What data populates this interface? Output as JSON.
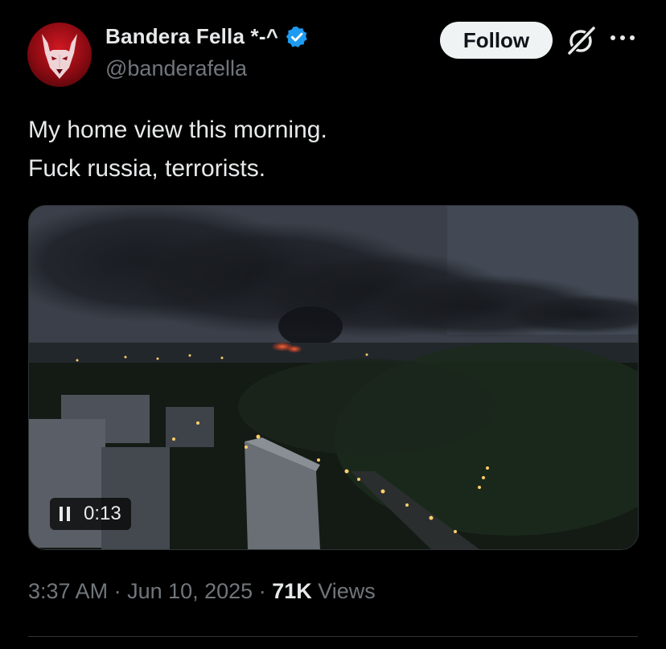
{
  "author": {
    "display_name": "Bandera Fella *-^",
    "handle": "@banderafella",
    "verified": true,
    "avatar_icon": "red-fox-mask-avatar"
  },
  "actions": {
    "follow_label": "Follow",
    "grok_icon": "grok-icon",
    "more_icon": "more-horizontal-icon"
  },
  "tweet": {
    "lines": [
      "My home view this morning.",
      "Fuck russia, terrorists."
    ]
  },
  "media": {
    "type": "video",
    "state_icon": "pause-icon",
    "elapsed": "0:13"
  },
  "meta": {
    "time": "3:37 AM",
    "sep1": " · ",
    "date": "Jun 10, 2025",
    "sep2": " · ",
    "views_count": "71K",
    "views_label": " Views"
  },
  "colors": {
    "background": "#000000",
    "text": "#e7e9ea",
    "secondary": "#71767b",
    "verified_blue": "#1d9bf0",
    "follow_bg": "#eff3f4"
  }
}
